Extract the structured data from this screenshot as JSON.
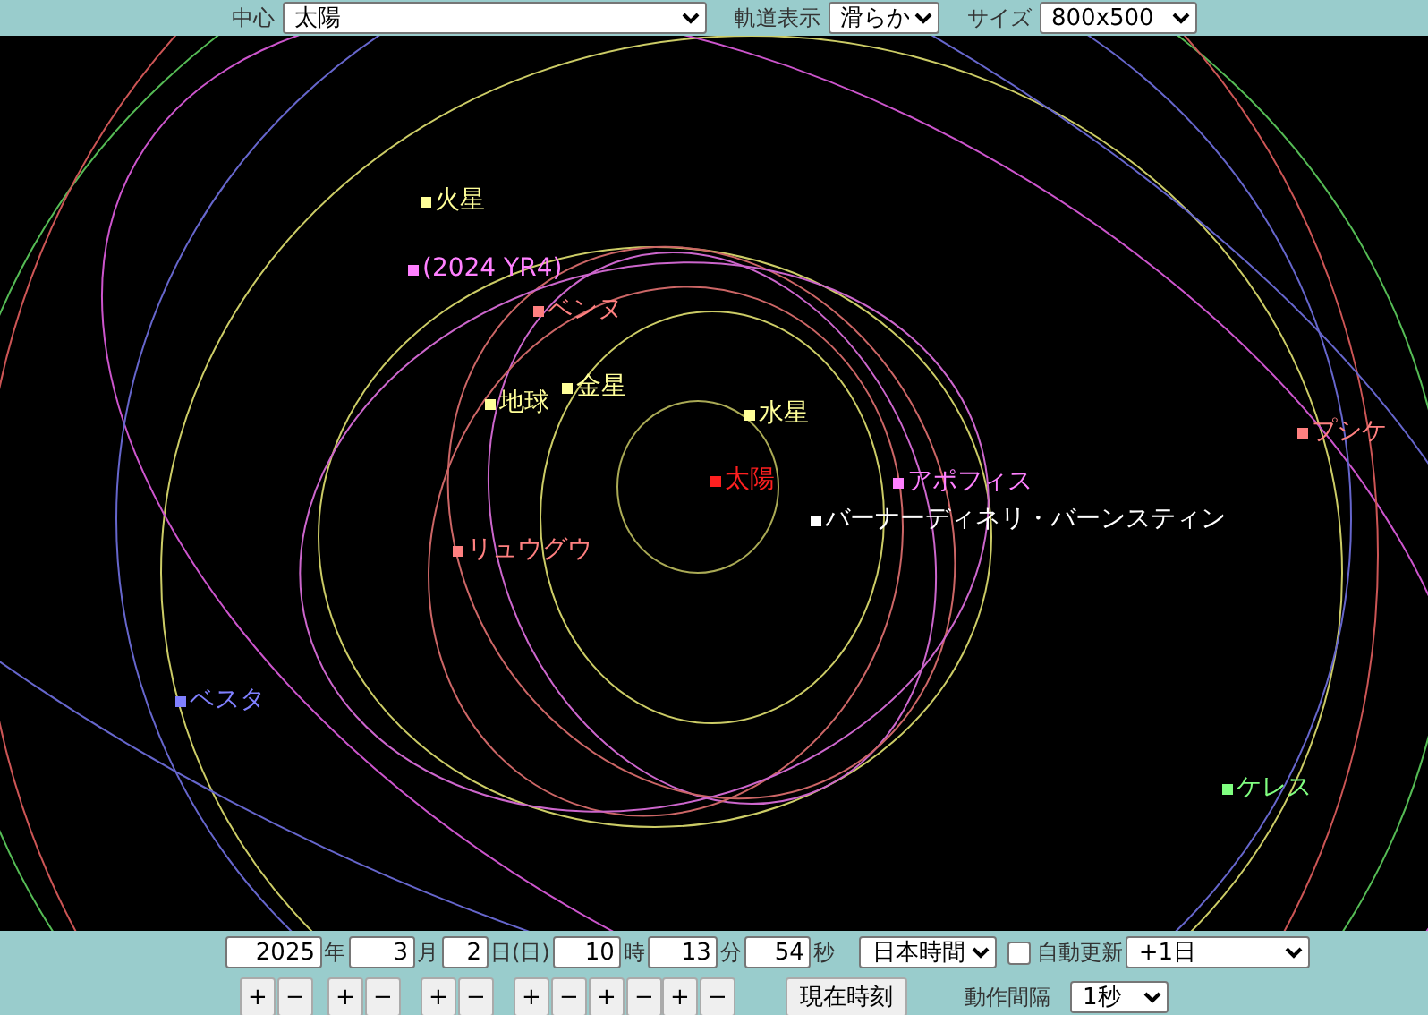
{
  "top_bar": {
    "center": {
      "label": "中心",
      "value": "太陽"
    },
    "orbit_display": {
      "label": "軌道表示",
      "value": "滑らか"
    },
    "size": {
      "label": "サイズ",
      "value": "800x500"
    }
  },
  "bodies": [
    {
      "name": "火星",
      "color": "#ffff99"
    },
    {
      "name": "(2024 YR4)",
      "color": "#ff80ff"
    },
    {
      "name": "ベンヌ",
      "color": "#ff8080"
    },
    {
      "name": "金星",
      "color": "#ffff99"
    },
    {
      "name": "地球",
      "color": "#ffff99"
    },
    {
      "name": "水星",
      "color": "#ffff99"
    },
    {
      "name": "太陽",
      "color": "#ff2020"
    },
    {
      "name": "アポフィス",
      "color": "#ff80ff"
    },
    {
      "name": "バーナーディネリ・バーンスティン",
      "color": "#ffffff"
    },
    {
      "name": "リュウグウ",
      "color": "#ff8080"
    },
    {
      "name": "プシケ",
      "color": "#ff8080"
    },
    {
      "name": "ベスタ",
      "color": "#8080ff"
    },
    {
      "name": "ケレス",
      "color": "#80ff80"
    }
  ],
  "time_controls": {
    "fields": [
      {
        "value": "2025",
        "unit": "年",
        "buttons": [
          "+",
          "−"
        ]
      },
      {
        "value": "3",
        "unit": "月",
        "buttons": [
          "+",
          "−"
        ]
      },
      {
        "value": "2",
        "unit": "日(日)",
        "buttons": [
          "+",
          "−"
        ]
      },
      {
        "value": "10",
        "unit": "時",
        "buttons": [
          "+",
          "−"
        ]
      },
      {
        "value": "13",
        "unit": "分",
        "buttons": [
          "+",
          "−"
        ]
      },
      {
        "value": "54",
        "unit": "秒",
        "buttons": [
          "+",
          "−"
        ]
      }
    ],
    "timezone": "日本時間",
    "auto_update": {
      "label": "自動更新",
      "checked": false
    },
    "step": "+1日",
    "now_button": "現在時刻",
    "interval": {
      "label": "動作間隔",
      "value": "1秒"
    }
  }
}
